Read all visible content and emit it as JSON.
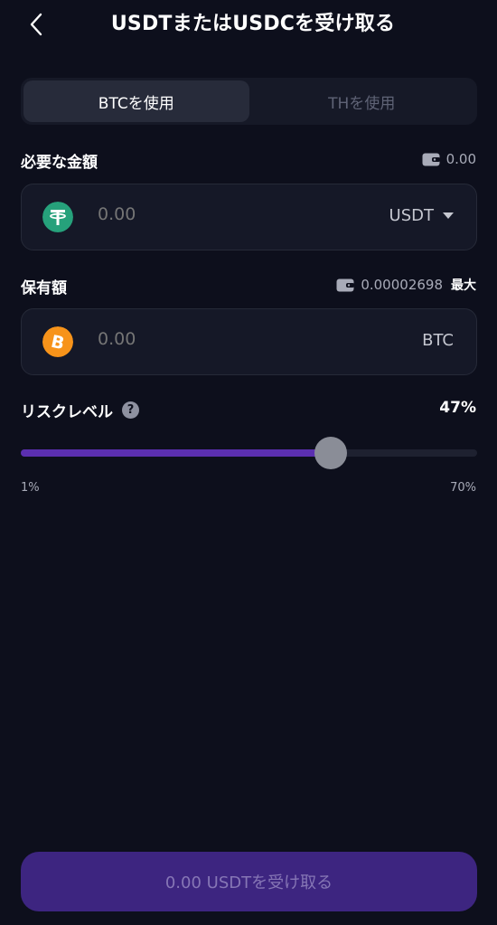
{
  "header": {
    "title": "USDTまたはUSDCを受け取る"
  },
  "tabs": [
    {
      "label": "BTCを使用",
      "active": true
    },
    {
      "label": "THを使用",
      "active": false
    }
  ],
  "required": {
    "label": "必要な金額",
    "balance": "0.00",
    "amount_placeholder": "0.00",
    "currency": "USDT",
    "icon": "tether-icon",
    "coin_color": "#26a17b"
  },
  "holding": {
    "label": "保有額",
    "balance": "0.00002698",
    "max_label": "最大",
    "amount_placeholder": "0.00",
    "currency": "BTC",
    "icon": "bitcoin-icon",
    "coin_color": "#f7931a"
  },
  "risk": {
    "label": "リスクレベル",
    "help_glyph": "?",
    "value": "47%",
    "level": 0.68,
    "min_label": "1%",
    "max_label": "70%"
  },
  "cta": {
    "label": "0.00 USDTを受け取る"
  },
  "colors": {
    "background": "#0d0f1c",
    "accent": "#5b2fb0",
    "button": "#3d2580"
  }
}
